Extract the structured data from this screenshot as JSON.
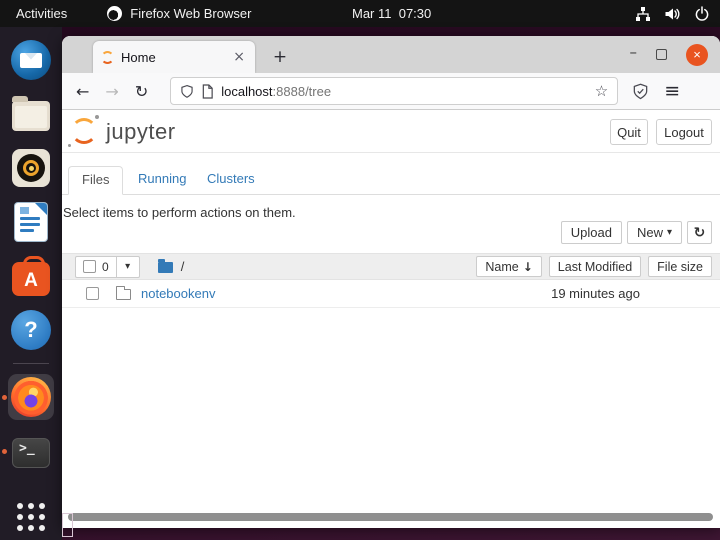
{
  "topbar": {
    "activities_label": "Activities",
    "app_label": "Firefox Web Browser",
    "clock": "Mar 11  07:30"
  },
  "dock": {
    "items": [
      "thunderbird",
      "files",
      "rhythmbox",
      "libreoffice-writer",
      "ubuntu-software",
      "help",
      "firefox",
      "terminal",
      "app-grid"
    ],
    "glyphs": {
      "software": "A",
      "help": "?",
      "terminal": ">_"
    },
    "active_item": "firefox",
    "running_items": [
      "firefox",
      "terminal"
    ]
  },
  "browser": {
    "tab_title": "Home",
    "tab_close_glyph": "×",
    "new_tab_glyph": "+",
    "minimize_glyph": "–",
    "close_glyph": "×",
    "back_glyph": "←",
    "forward_glyph": "→",
    "reload_glyph": "↻",
    "url_host": "localhost",
    "url_path": ":8888/tree",
    "star_glyph": "☆",
    "menu_glyph": "≡"
  },
  "page": {
    "brand": "jupyter",
    "quit_label": "Quit",
    "logout_label": "Logout",
    "tabs": [
      {
        "label": "Files",
        "active": true
      },
      {
        "label": "Running",
        "active": false
      },
      {
        "label": "Clusters",
        "active": false
      }
    ],
    "hint": "Select items to perform actions on them.",
    "upload_label": "Upload",
    "new_label": "New",
    "caret_glyph": "▾",
    "refresh_glyph": "↻",
    "listing": {
      "selected_count": "0",
      "select_caret_glyph": "▾",
      "breadcrumb": "/",
      "name_header": "Name",
      "name_sort_glyph": "↓",
      "modified_header": "Last Modified",
      "size_header": "File size",
      "rows": [
        {
          "name": "notebookenv",
          "modified": "19 minutes ago",
          "size": ""
        }
      ]
    }
  },
  "colors": {
    "ubuntu_orange": "#e95420",
    "jupyter_orange": "#f37626",
    "link_blue": "#337ab7",
    "topbar_bg": "#141414",
    "desktop_purple": "#2e0d26"
  }
}
